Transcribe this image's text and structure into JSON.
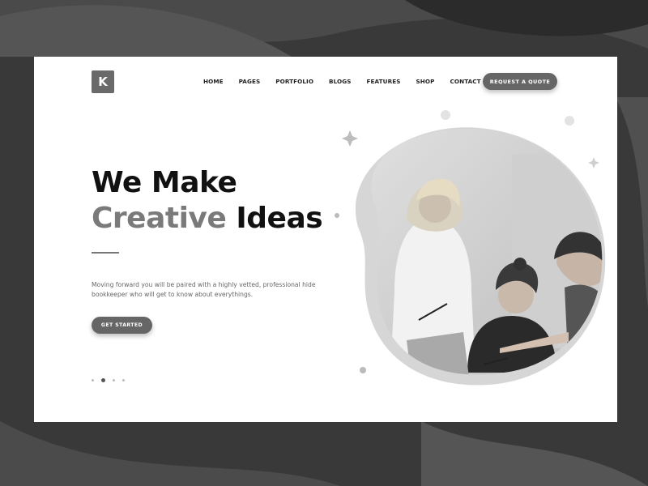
{
  "header": {
    "logo_letter": "K",
    "nav": [
      "HOME",
      "PAGES",
      "PORTFOLIO",
      "BLOGS",
      "FEATURES",
      "SHOP",
      "CONTACT"
    ],
    "cta_label": "REQUEST A QUOTE"
  },
  "hero": {
    "title_line1": "We Make",
    "title_accent": "Creative",
    "title_rest": "Ideas",
    "description": "Moving forward you will be paired with a highly vetted, professional hide bookkeeper who will get to know about everythings.",
    "button_label": "GET STARTED"
  },
  "slider": {
    "count": 4,
    "active_index": 1
  },
  "colors": {
    "background": "#3a3a3a",
    "card": "#ffffff",
    "accent_gray": "#666666",
    "title_dark": "#111111",
    "title_accent": "#7a7a7a"
  },
  "icons": [
    "sparkle-icon",
    "dot-icon"
  ]
}
